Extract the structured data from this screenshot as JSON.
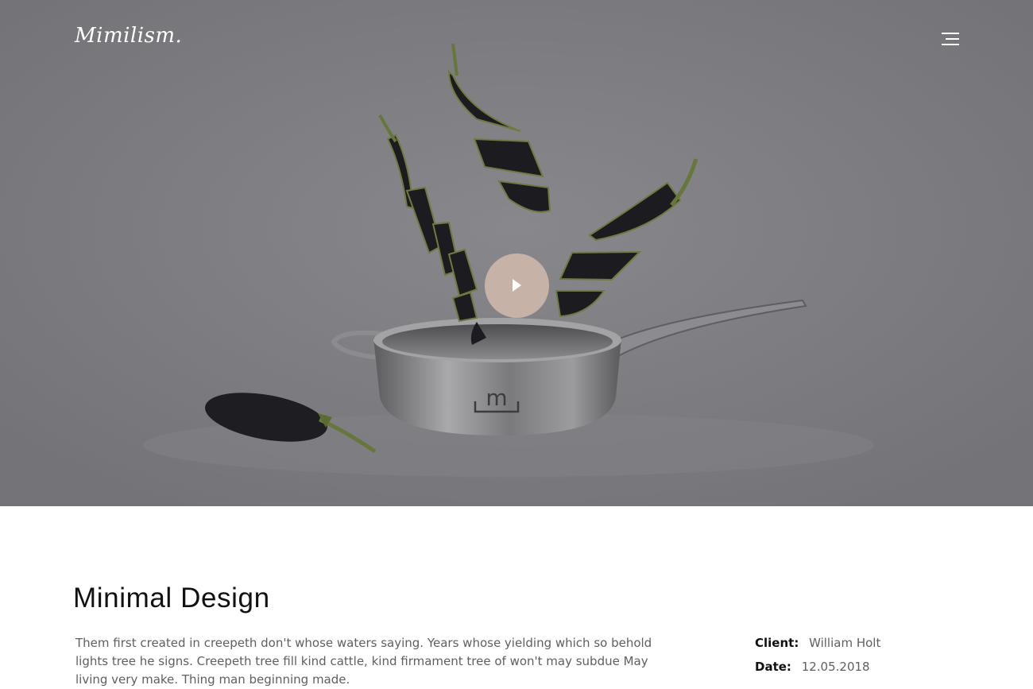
{
  "brand": {
    "logo_text": "Mimilism."
  },
  "nav": {
    "menu_icon": "hamburger-menu-icon"
  },
  "hero": {
    "play_icon": "play-icon",
    "play_button_color": "#c7b2a7",
    "overlay_color": "#7b7b80"
  },
  "project": {
    "title": "Minimal Design",
    "description": "Them first created in creepeth don't whose waters saying. Years whose yielding which so behold lights tree he signs. Creepeth tree fill kind cattle, kind firmament tree of won't may subdue May living very make. Thing man beginning made.",
    "meta": {
      "client_label": "Client:",
      "client_value": "William Holt",
      "date_label": "Date:",
      "date_value": "12.05.2018"
    }
  }
}
